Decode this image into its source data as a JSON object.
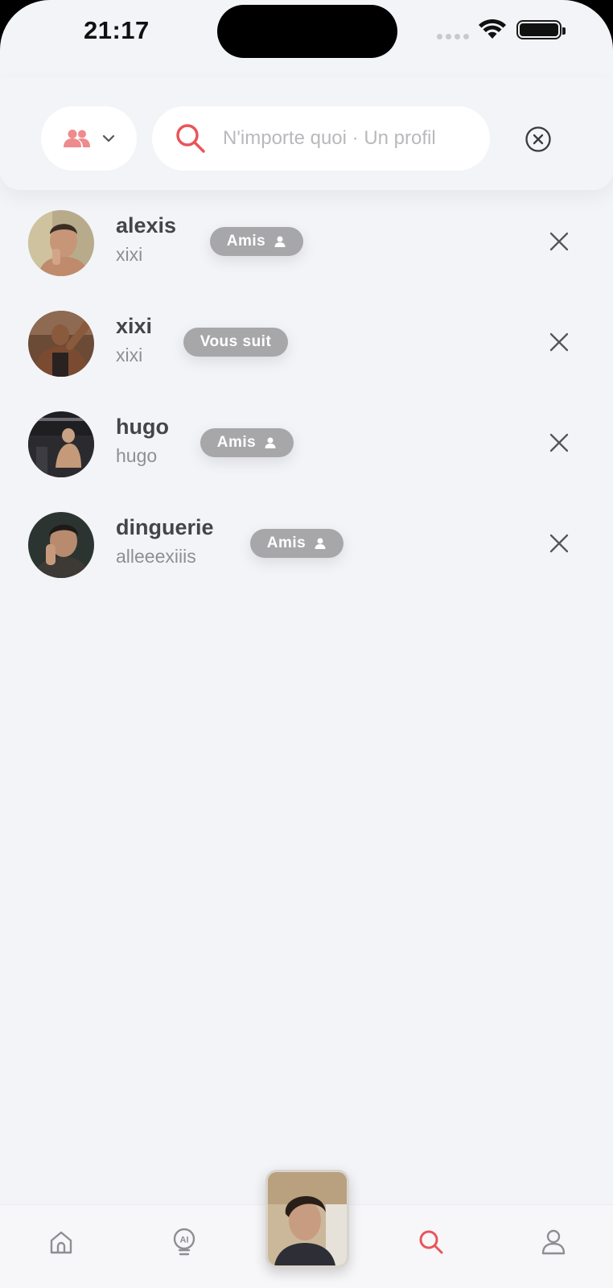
{
  "status_bar": {
    "time": "21:17"
  },
  "search": {
    "placeholder": "N'importe quoi · Un profil",
    "value": "",
    "filter_icon": "people-icon",
    "accent_color": "#e8555a"
  },
  "results": [
    {
      "name": "alexis",
      "handle": "xixi",
      "badge": "Amis",
      "badge_icon": "person-icon"
    },
    {
      "name": "xixi",
      "handle": "xixi",
      "badge": "Vous suit",
      "badge_icon": ""
    },
    {
      "name": "hugo",
      "handle": "hugo",
      "badge": "Amis",
      "badge_icon": "person-icon"
    },
    {
      "name": "dinguerie",
      "handle": "alleeexiiis",
      "badge": "Amis",
      "badge_icon": "person-icon"
    }
  ],
  "tabbar": {
    "tabs": [
      {
        "icon": "home-icon",
        "active": false
      },
      {
        "icon": "ai-bulb-icon",
        "active": false
      },
      {
        "icon": "camera-preview",
        "active": false
      },
      {
        "icon": "search-icon",
        "active": true
      },
      {
        "icon": "profile-icon",
        "active": false
      }
    ],
    "active_color": "#e8555a",
    "inactive_color": "#8e8e93"
  }
}
